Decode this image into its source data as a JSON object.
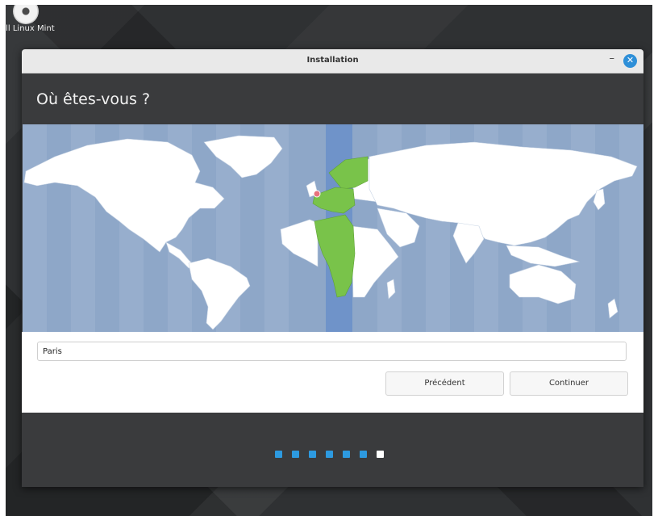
{
  "desktop": {
    "icon_label": "all Linux Mint"
  },
  "window": {
    "title": "Installation",
    "minimize": "–",
    "close": "✕"
  },
  "page": {
    "heading": "Où êtes-vous ?"
  },
  "location": {
    "city_value": "Paris"
  },
  "buttons": {
    "previous": "Précédent",
    "continue": "Continuer"
  },
  "progress": {
    "total_steps": 7,
    "current_step": 7
  },
  "colors": {
    "ocean": "#8ea7c8",
    "land": "#ffffff",
    "selected_timezone": "#79c34a",
    "timezone_band": "#6f93c9",
    "accent": "#2e8fd8",
    "marker": "#e8737d"
  }
}
